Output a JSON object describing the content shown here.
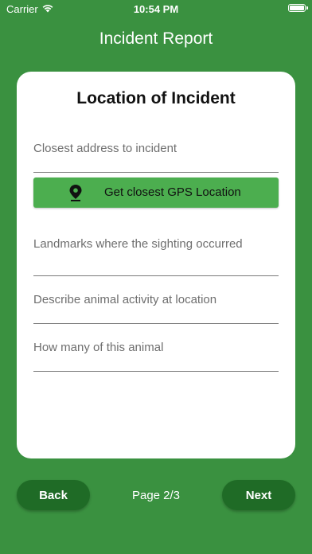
{
  "status_bar": {
    "carrier": "Carrier",
    "time": "10:54 PM"
  },
  "header": {
    "title": "Incident Report"
  },
  "card": {
    "title": "Location of Incident",
    "fields": {
      "address": "Closest address to incident",
      "landmarks": "Landmarks where the sighting occurred",
      "activity": "Describe animal activity at location",
      "count": "How many of this animal"
    },
    "gps_button": {
      "label": "Get closest GPS Location",
      "icon": "location-pin-icon"
    }
  },
  "footer": {
    "back_label": "Back",
    "next_label": "Next",
    "page_indicator": "Page 2/3"
  },
  "colors": {
    "background": "#3a9140",
    "gps_button": "#4cae4f",
    "nav_button": "#1f6b26"
  }
}
